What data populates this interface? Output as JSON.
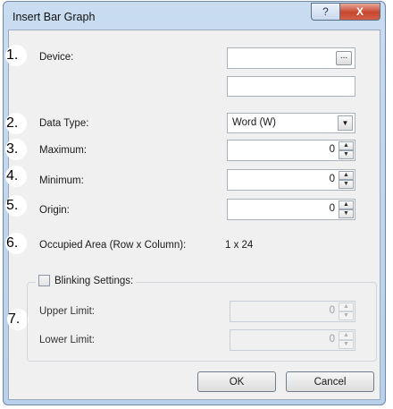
{
  "window": {
    "title": "Insert Bar Graph",
    "help_label": "?",
    "close_label": "X"
  },
  "steps": [
    "1.",
    "2.",
    "3.",
    "4.",
    "5.",
    "6.",
    "7."
  ],
  "device": {
    "label": "Device:",
    "value": "",
    "sub_value": "",
    "browse_label": "..."
  },
  "data_type": {
    "label": "Data Type:",
    "selected": "Word (W)"
  },
  "maximum": {
    "label": "Maximum:",
    "value": "0"
  },
  "minimum": {
    "label": "Minimum:",
    "value": "0"
  },
  "origin": {
    "label": "Origin:",
    "value": "0"
  },
  "occupied_area": {
    "label": "Occupied Area (Row x Column):",
    "value": "1 x 24"
  },
  "blinking": {
    "label": "Blinking Settings:",
    "checked": false,
    "upper_label": "Upper Limit:",
    "upper_value": "0",
    "lower_label": "Lower Limit:",
    "lower_value": "0"
  },
  "buttons": {
    "ok": "OK",
    "cancel": "Cancel"
  }
}
